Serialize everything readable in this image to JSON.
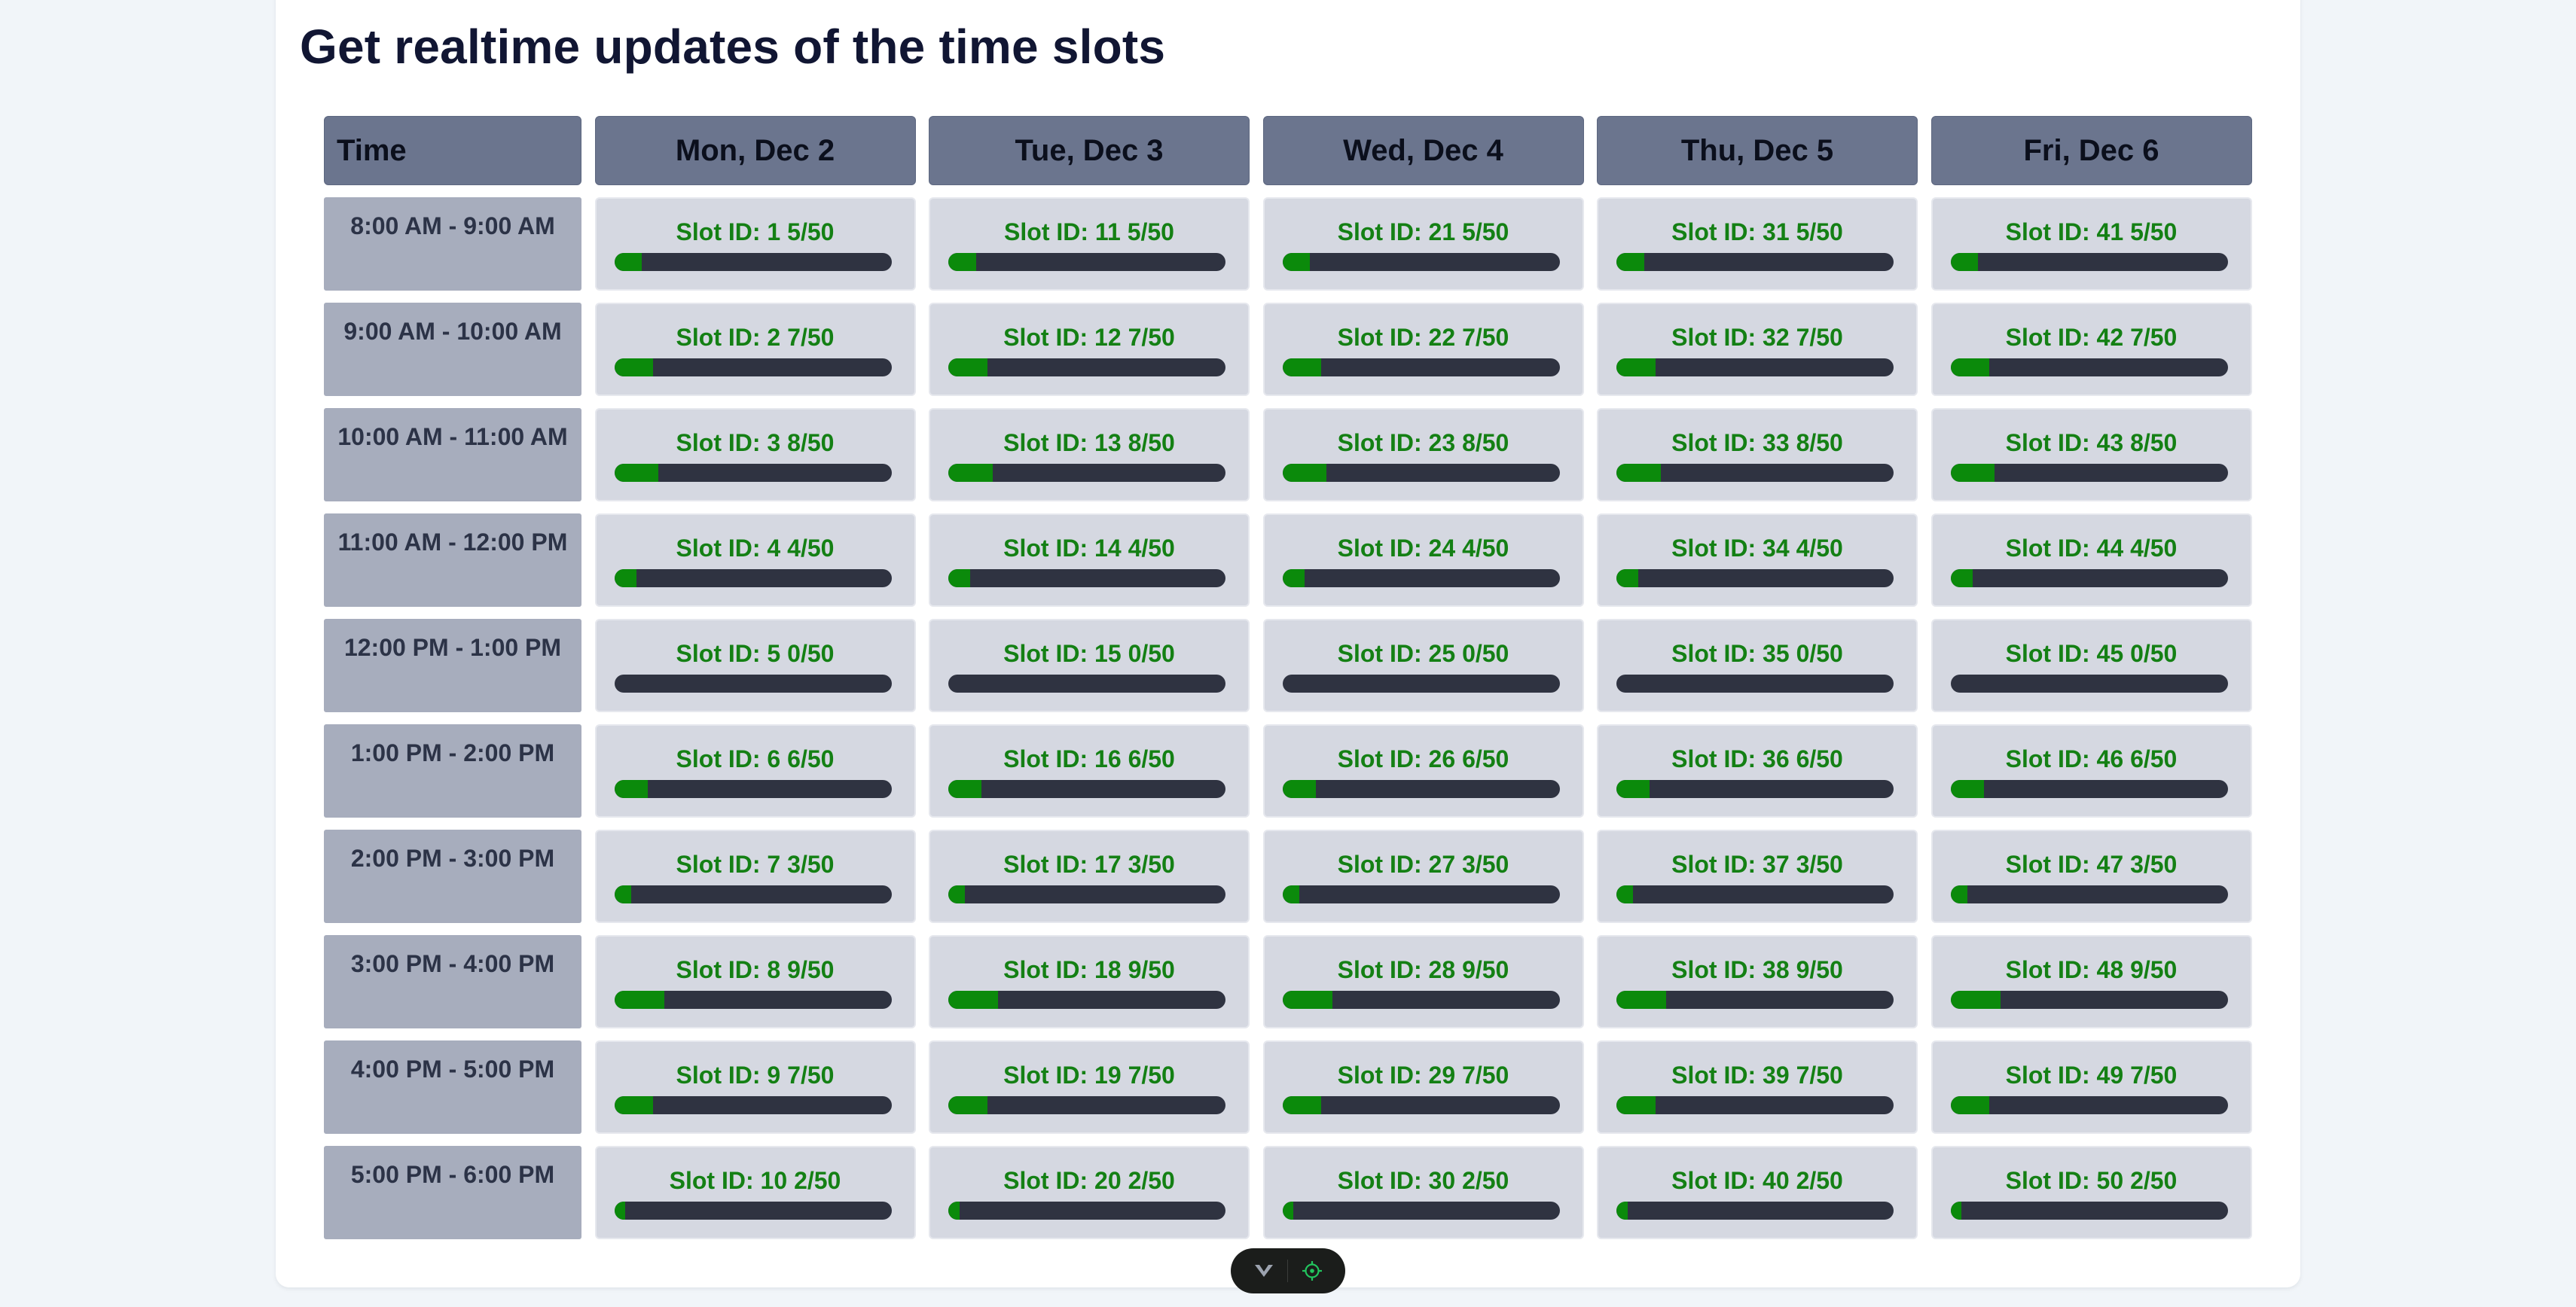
{
  "page": {
    "title": "Get realtime updates of the time slots"
  },
  "table": {
    "time_header": "Time",
    "days": [
      "Mon, Dec 2",
      "Tue, Dec 3",
      "Wed, Dec 4",
      "Thu, Dec 5",
      "Fri, Dec 6"
    ],
    "rows": [
      {
        "time": "8:00 AM - 9:00 AM",
        "slots": [
          {
            "id": "Slot ID: 1",
            "count": "5/50",
            "filled": 5,
            "capacity": 50
          },
          {
            "id": "Slot ID: 11",
            "count": "5/50",
            "filled": 5,
            "capacity": 50
          },
          {
            "id": "Slot ID: 21",
            "count": "5/50",
            "filled": 5,
            "capacity": 50
          },
          {
            "id": "Slot ID: 31",
            "count": "5/50",
            "filled": 5,
            "capacity": 50
          },
          {
            "id": "Slot ID: 41",
            "count": "5/50",
            "filled": 5,
            "capacity": 50
          }
        ]
      },
      {
        "time": "9:00 AM - 10:00 AM",
        "slots": [
          {
            "id": "Slot ID: 2",
            "count": "7/50",
            "filled": 7,
            "capacity": 50
          },
          {
            "id": "Slot ID: 12",
            "count": "7/50",
            "filled": 7,
            "capacity": 50
          },
          {
            "id": "Slot ID: 22",
            "count": "7/50",
            "filled": 7,
            "capacity": 50
          },
          {
            "id": "Slot ID: 32",
            "count": "7/50",
            "filled": 7,
            "capacity": 50
          },
          {
            "id": "Slot ID: 42",
            "count": "7/50",
            "filled": 7,
            "capacity": 50
          }
        ]
      },
      {
        "time": "10:00 AM - 11:00 AM",
        "slots": [
          {
            "id": "Slot ID: 3",
            "count": "8/50",
            "filled": 8,
            "capacity": 50
          },
          {
            "id": "Slot ID: 13",
            "count": "8/50",
            "filled": 8,
            "capacity": 50
          },
          {
            "id": "Slot ID: 23",
            "count": "8/50",
            "filled": 8,
            "capacity": 50
          },
          {
            "id": "Slot ID: 33",
            "count": "8/50",
            "filled": 8,
            "capacity": 50
          },
          {
            "id": "Slot ID: 43",
            "count": "8/50",
            "filled": 8,
            "capacity": 50
          }
        ]
      },
      {
        "time": "11:00 AM - 12:00 PM",
        "slots": [
          {
            "id": "Slot ID: 4",
            "count": "4/50",
            "filled": 4,
            "capacity": 50
          },
          {
            "id": "Slot ID: 14",
            "count": "4/50",
            "filled": 4,
            "capacity": 50
          },
          {
            "id": "Slot ID: 24",
            "count": "4/50",
            "filled": 4,
            "capacity": 50
          },
          {
            "id": "Slot ID: 34",
            "count": "4/50",
            "filled": 4,
            "capacity": 50
          },
          {
            "id": "Slot ID: 44",
            "count": "4/50",
            "filled": 4,
            "capacity": 50
          }
        ]
      },
      {
        "time": "12:00 PM - 1:00 PM",
        "slots": [
          {
            "id": "Slot ID: 5",
            "count": "0/50",
            "filled": 0,
            "capacity": 50
          },
          {
            "id": "Slot ID: 15",
            "count": "0/50",
            "filled": 0,
            "capacity": 50
          },
          {
            "id": "Slot ID: 25",
            "count": "0/50",
            "filled": 0,
            "capacity": 50
          },
          {
            "id": "Slot ID: 35",
            "count": "0/50",
            "filled": 0,
            "capacity": 50
          },
          {
            "id": "Slot ID: 45",
            "count": "0/50",
            "filled": 0,
            "capacity": 50
          }
        ]
      },
      {
        "time": "1:00 PM - 2:00 PM",
        "slots": [
          {
            "id": "Slot ID: 6",
            "count": "6/50",
            "filled": 6,
            "capacity": 50
          },
          {
            "id": "Slot ID: 16",
            "count": "6/50",
            "filled": 6,
            "capacity": 50
          },
          {
            "id": "Slot ID: 26",
            "count": "6/50",
            "filled": 6,
            "capacity": 50
          },
          {
            "id": "Slot ID: 36",
            "count": "6/50",
            "filled": 6,
            "capacity": 50
          },
          {
            "id": "Slot ID: 46",
            "count": "6/50",
            "filled": 6,
            "capacity": 50
          }
        ]
      },
      {
        "time": "2:00 PM - 3:00 PM",
        "slots": [
          {
            "id": "Slot ID: 7",
            "count": "3/50",
            "filled": 3,
            "capacity": 50
          },
          {
            "id": "Slot ID: 17",
            "count": "3/50",
            "filled": 3,
            "capacity": 50
          },
          {
            "id": "Slot ID: 27",
            "count": "3/50",
            "filled": 3,
            "capacity": 50
          },
          {
            "id": "Slot ID: 37",
            "count": "3/50",
            "filled": 3,
            "capacity": 50
          },
          {
            "id": "Slot ID: 47",
            "count": "3/50",
            "filled": 3,
            "capacity": 50
          }
        ]
      },
      {
        "time": "3:00 PM - 4:00 PM",
        "slots": [
          {
            "id": "Slot ID: 8",
            "count": "9/50",
            "filled": 9,
            "capacity": 50
          },
          {
            "id": "Slot ID: 18",
            "count": "9/50",
            "filled": 9,
            "capacity": 50
          },
          {
            "id": "Slot ID: 28",
            "count": "9/50",
            "filled": 9,
            "capacity": 50
          },
          {
            "id": "Slot ID: 38",
            "count": "9/50",
            "filled": 9,
            "capacity": 50
          },
          {
            "id": "Slot ID: 48",
            "count": "9/50",
            "filled": 9,
            "capacity": 50
          }
        ]
      },
      {
        "time": "4:00 PM - 5:00 PM",
        "slots": [
          {
            "id": "Slot ID: 9",
            "count": "7/50",
            "filled": 7,
            "capacity": 50
          },
          {
            "id": "Slot ID: 19",
            "count": "7/50",
            "filled": 7,
            "capacity": 50
          },
          {
            "id": "Slot ID: 29",
            "count": "7/50",
            "filled": 7,
            "capacity": 50
          },
          {
            "id": "Slot ID: 39",
            "count": "7/50",
            "filled": 7,
            "capacity": 50
          },
          {
            "id": "Slot ID: 49",
            "count": "7/50",
            "filled": 7,
            "capacity": 50
          }
        ]
      },
      {
        "time": "5:00 PM - 6:00 PM",
        "slots": [
          {
            "id": "Slot ID: 10",
            "count": "2/50",
            "filled": 2,
            "capacity": 50
          },
          {
            "id": "Slot ID: 20",
            "count": "2/50",
            "filled": 2,
            "capacity": 50
          },
          {
            "id": "Slot ID: 30",
            "count": "2/50",
            "filled": 2,
            "capacity": 50
          },
          {
            "id": "Slot ID: 40",
            "count": "2/50",
            "filled": 2,
            "capacity": 50
          },
          {
            "id": "Slot ID: 50",
            "count": "2/50",
            "filled": 2,
            "capacity": 50
          }
        ]
      }
    ]
  },
  "toolbar": {
    "icons": [
      "chevron-down-icon",
      "crosshair-icon"
    ]
  },
  "colors": {
    "page_background": "#f1f5f9",
    "day_header": "#6b758e",
    "time_cell": "#a7adbd",
    "slot_cell": "#d5d8e1",
    "slot_text": "#148014",
    "bar_track": "#2f3341",
    "bar_fill": "#0b8a0b",
    "toolbar_background": "#1b1d1b",
    "toolbar_accent": "#22c55e"
  }
}
